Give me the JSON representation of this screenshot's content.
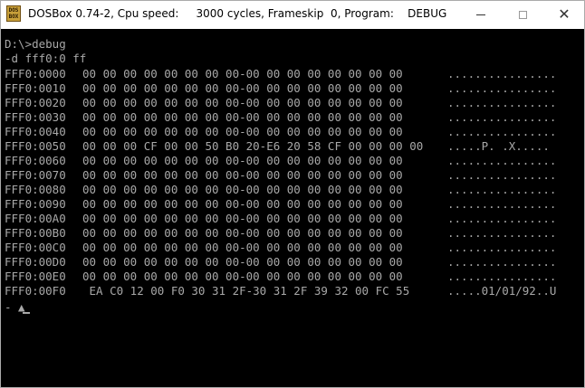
{
  "window": {
    "icon_text": "DOS BOX",
    "title": "DOSBox 0.74-2, Cpu speed:     3000 cycles, Frameskip  0, Program:    DEBUG",
    "controls": {
      "minimize": "minimize",
      "maximize": "maximize",
      "close": "✕"
    }
  },
  "console": {
    "prompt_line": "D:\\>debug",
    "command_line": "-d fff0:0 ff",
    "dump_rows": [
      {
        "address": "FFF0:0000",
        "hex": "00 00 00 00 00 00 00 00-00 00 00 00 00 00 00 00",
        "ascii": "................"
      },
      {
        "address": "FFF0:0010",
        "hex": "00 00 00 00 00 00 00 00-00 00 00 00 00 00 00 00",
        "ascii": "................"
      },
      {
        "address": "FFF0:0020",
        "hex": "00 00 00 00 00 00 00 00-00 00 00 00 00 00 00 00",
        "ascii": "................"
      },
      {
        "address": "FFF0:0030",
        "hex": "00 00 00 00 00 00 00 00-00 00 00 00 00 00 00 00",
        "ascii": "................"
      },
      {
        "address": "FFF0:0040",
        "hex": "00 00 00 00 00 00 00 00-00 00 00 00 00 00 00 00",
        "ascii": "................"
      },
      {
        "address": "FFF0:0050",
        "hex": "00 00 00 CF 00 00 50 B0 20-E6 20 58 CF 00 00 00 00",
        "ascii": ".....P. .X....."
      },
      {
        "address": "FFF0:0060",
        "hex": "00 00 00 00 00 00 00 00-00 00 00 00 00 00 00 00",
        "ascii": "................"
      },
      {
        "address": "FFF0:0070",
        "hex": "00 00 00 00 00 00 00 00-00 00 00 00 00 00 00 00",
        "ascii": "................"
      },
      {
        "address": "FFF0:0080",
        "hex": "00 00 00 00 00 00 00 00-00 00 00 00 00 00 00 00",
        "ascii": "................"
      },
      {
        "address": "FFF0:0090",
        "hex": "00 00 00 00 00 00 00 00-00 00 00 00 00 00 00 00",
        "ascii": "................"
      },
      {
        "address": "FFF0:00A0",
        "hex": "00 00 00 00 00 00 00 00-00 00 00 00 00 00 00 00",
        "ascii": "................"
      },
      {
        "address": "FFF0:00B0",
        "hex": "00 00 00 00 00 00 00 00-00 00 00 00 00 00 00 00",
        "ascii": "................"
      },
      {
        "address": "FFF0:00C0",
        "hex": "00 00 00 00 00 00 00 00-00 00 00 00 00 00 00 00",
        "ascii": "................"
      },
      {
        "address": "FFF0:00D0",
        "hex": "00 00 00 00 00 00 00 00-00 00 00 00 00 00 00 00",
        "ascii": "................"
      },
      {
        "address": "FFF0:00E0",
        "hex": "00 00 00 00 00 00 00 00-00 00 00 00 00 00 00 00",
        "ascii": "................"
      },
      {
        "address": "FFF0:00F0",
        "hex": " EA C0 12 00 F0 30 31 2F-30 31 2F 39 32 00 FC 55",
        "ascii": ".....01/01/92..U"
      }
    ],
    "input_line": "- ▲"
  }
}
